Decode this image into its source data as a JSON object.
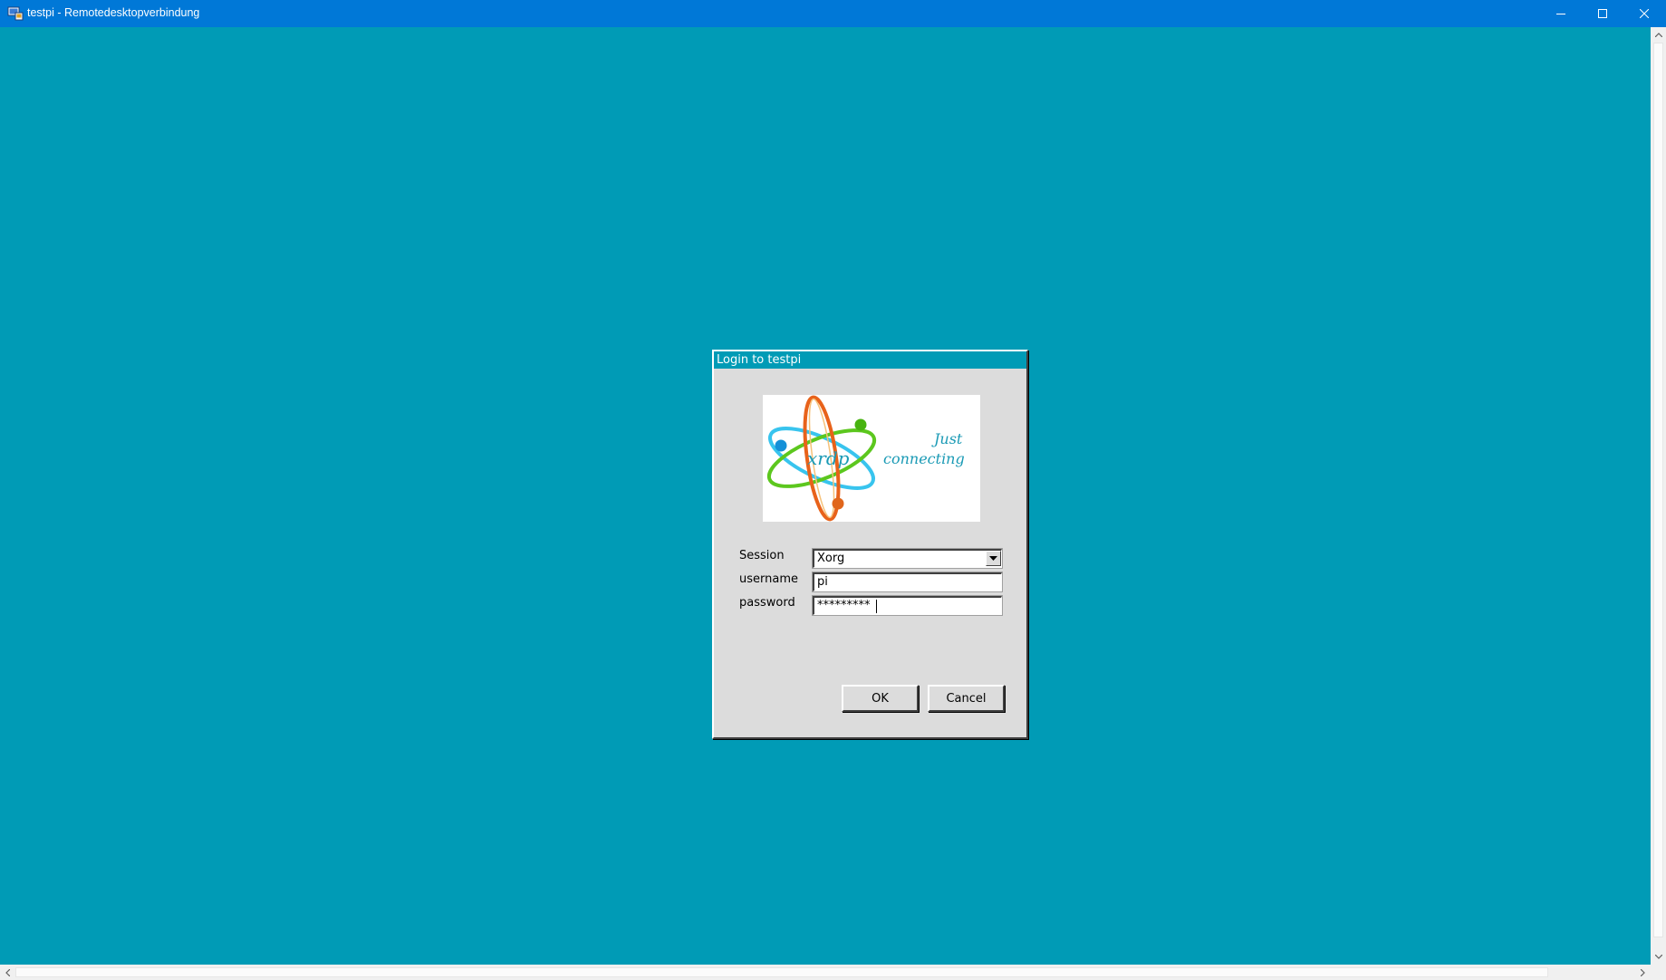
{
  "window": {
    "title": "testpi - Remotedesktopverbindung",
    "icon": "remote-desktop-icon",
    "controls": [
      "minimize-icon",
      "maximize-icon",
      "close-icon"
    ]
  },
  "colors": {
    "titlebar": "#0078d7",
    "desktop": "#009bb6",
    "dialog_bg": "#dcdcdc",
    "logo_accent": "#1a9ab5"
  },
  "dialog": {
    "title": "Login to testpi",
    "logo": {
      "brand": "xrdp",
      "slogan_line1": "Just",
      "slogan_line2": "connecting"
    },
    "session": {
      "label": "Session",
      "value": "Xorg"
    },
    "username": {
      "label": "username",
      "value": "pi"
    },
    "password": {
      "label": "password",
      "value": "*********"
    },
    "ok_label": "OK",
    "cancel_label": "Cancel"
  }
}
